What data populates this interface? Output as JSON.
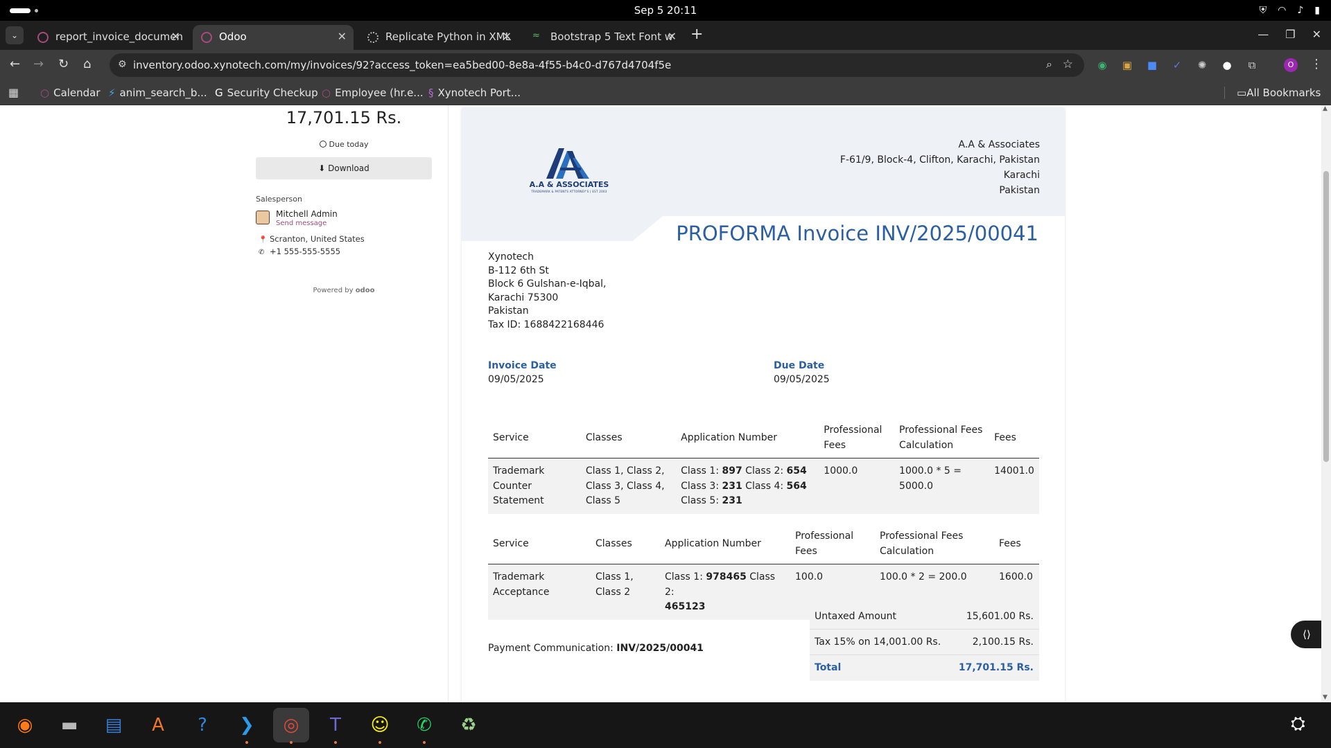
{
  "system": {
    "clock": "Sep 5  20:11",
    "tray_icons": [
      "shield-icon",
      "wifi-icon",
      "volume-icon",
      "battery-icon"
    ]
  },
  "browser": {
    "tabs": [
      {
        "label": "report_invoice_documen",
        "active": false
      },
      {
        "label": "Odoo",
        "active": true
      },
      {
        "label": "Replicate Python in XML",
        "active": false
      },
      {
        "label": "Bootstrap 5 Text Font w",
        "active": false
      }
    ],
    "url": "inventory.odoo.xynotech.com/my/invoices/92?access_token=ea5bed00-8e8a-4f55-b4c0-d767d4704f5e",
    "profile_initial": "O",
    "bookmarks": [
      {
        "label": "Calendar"
      },
      {
        "label": "anim_search_b..."
      },
      {
        "label": "Security Checkup"
      },
      {
        "label": "Employee (hr.e..."
      },
      {
        "label": "Xynotech Port..."
      }
    ],
    "all_bookmarks": "All Bookmarks"
  },
  "sidebar": {
    "amount": "17,701.15 Rs.",
    "due": "Due today",
    "download_label": "Download",
    "salesperson_label": "Salesperson",
    "salesperson_name": "Mitchell Admin",
    "send_message": "Send message",
    "location": "Scranton, United States",
    "phone": "+1 555-555-5555",
    "powered_by": "Powered by",
    "powered_brand": "odoo"
  },
  "invoice": {
    "logo_text": "A.A & ASSOCIATES",
    "logo_tagline": "TRADEMARK & PATENTS ATTORNEY'S | EST 2003",
    "company": [
      "A.A & Associates",
      "F-61/9, Block-4, Clifton, Karachi, Pakistan",
      "Karachi",
      "Pakistan"
    ],
    "title": "PROFORMA Invoice INV/2025/00041",
    "customer": [
      "Xynotech",
      "B-112 6th St",
      "Block 6 Gulshan-e-Iqbal,",
      "Karachi 75300",
      "Pakistan",
      "Tax ID: 1688422168446"
    ],
    "invoice_date_label": "Invoice Date",
    "invoice_date": "09/05/2025",
    "due_date_label": "Due Date",
    "due_date": "09/05/2025",
    "headers": [
      "Service",
      "Classes",
      "Application Number",
      "Professional Fees",
      "Professional Fees Calculation",
      "Fees"
    ],
    "line1": {
      "service": "Trademark Counter Statement",
      "classes": "Class 1, Class 2, Class 3, Class 4, Class 5",
      "apps": [
        {
          "label": "Class 1:",
          "num": "897"
        },
        {
          "label": "Class 2:",
          "num": "654"
        },
        {
          "label": "Class 3:",
          "num": "231"
        },
        {
          "label": "Class 4:",
          "num": "564"
        },
        {
          "label": "Class 5:",
          "num": "231"
        }
      ],
      "prof_fees": "1000.0",
      "calc": "1000.0 * 5 = 5000.0",
      "fees": "14001.0"
    },
    "line2": {
      "service": "Trademark Acceptance",
      "classes": "Class 1, Class 2",
      "apps": [
        {
          "label": "Class 1:",
          "num": "978465"
        },
        {
          "label": "Class 2:",
          "num": "465123"
        }
      ],
      "prof_fees": "100.0",
      "calc": "100.0 * 2 = 200.0",
      "fees": "1600.0"
    },
    "payment_label": "Payment Communication:",
    "payment_ref": "INV/2025/00041",
    "totals": {
      "untaxed_label": "Untaxed Amount",
      "untaxed": "15,601.00 Rs.",
      "tax_label": "Tax 15% on 14,001.00 Rs.",
      "tax": "2,100.15 Rs.",
      "total_label": "Total",
      "total": "17,701.15 Rs."
    }
  },
  "dock": {
    "apps": [
      "firefox-icon",
      "files-icon",
      "writer-icon",
      "app-center-icon",
      "help-icon",
      "vscode-icon",
      "chrome-icon",
      "teams-icon",
      "snapchat-icon",
      "whatsapp-icon",
      "trash-icon"
    ]
  }
}
